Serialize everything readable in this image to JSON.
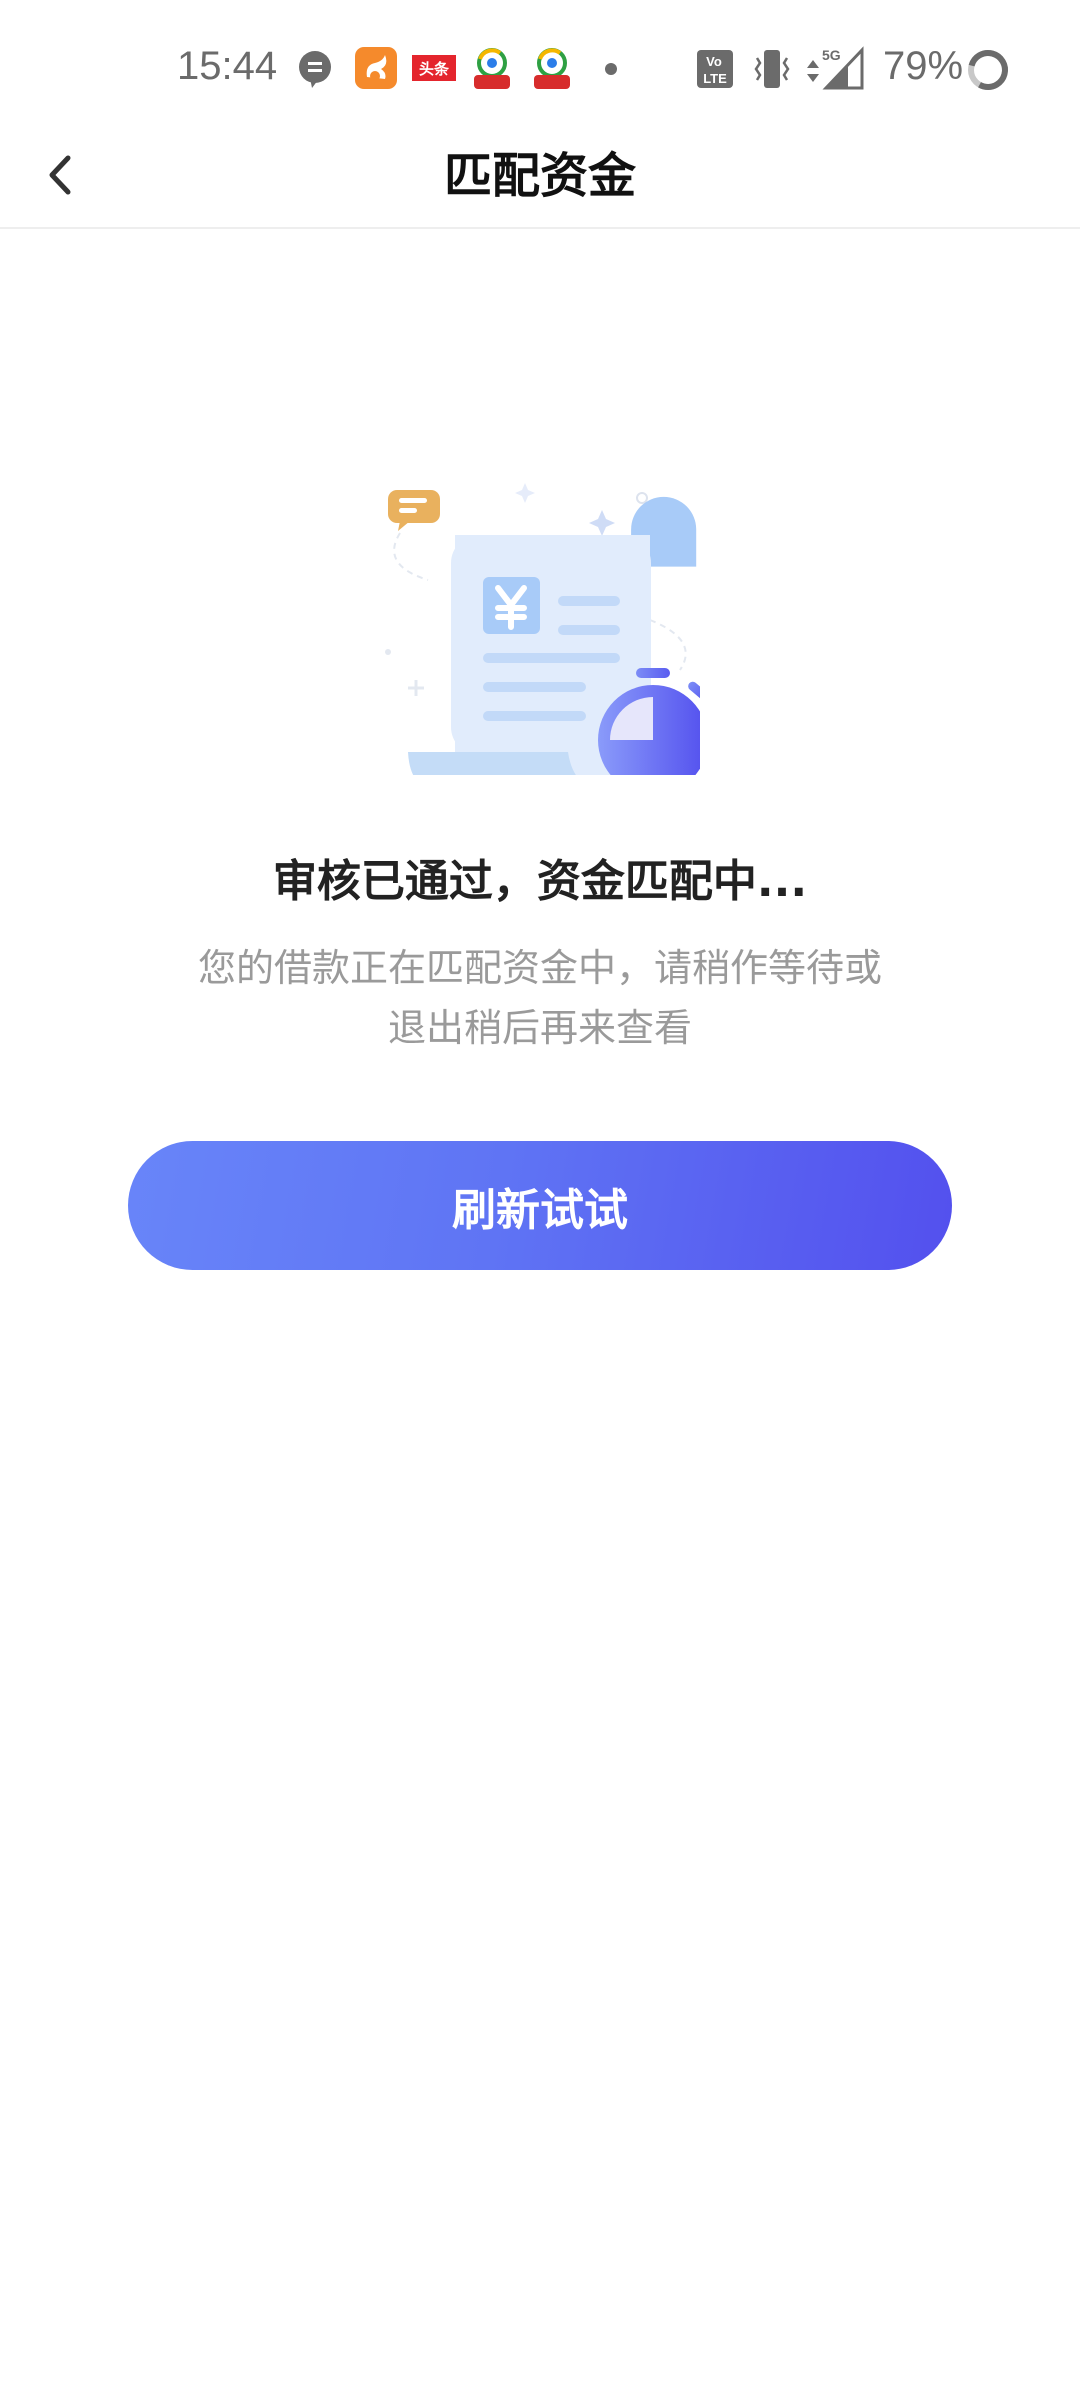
{
  "status_bar": {
    "time": "15:44",
    "notification_icons": [
      "message-bubble-icon",
      "uc-browser-icon",
      "toutiao-icon",
      "app-icon",
      "app-icon",
      "more-dot-icon"
    ],
    "toutiao_label": "头条",
    "network": "5G",
    "battery_percent": "79%",
    "system_icons": [
      "volte-icon",
      "vibrate-icon",
      "data-arrows-icon",
      "signal-icon",
      "battery-ring-icon"
    ]
  },
  "header": {
    "title": "匹配资金",
    "back_icon": "chevron-left-icon"
  },
  "main": {
    "illustration": "document-stopwatch-illustration",
    "heading": "审核已通过，资金匹配中...",
    "subtitle_line1": "您的借款正在匹配资金中，请稍作等待或",
    "subtitle_line2": "退出稍后再来查看",
    "refresh_label": "刷新试试"
  },
  "colors": {
    "accent_start": "#6885f9",
    "accent_end": "#5350ee",
    "subtitle": "#9a9a9a",
    "heading": "#222222"
  }
}
